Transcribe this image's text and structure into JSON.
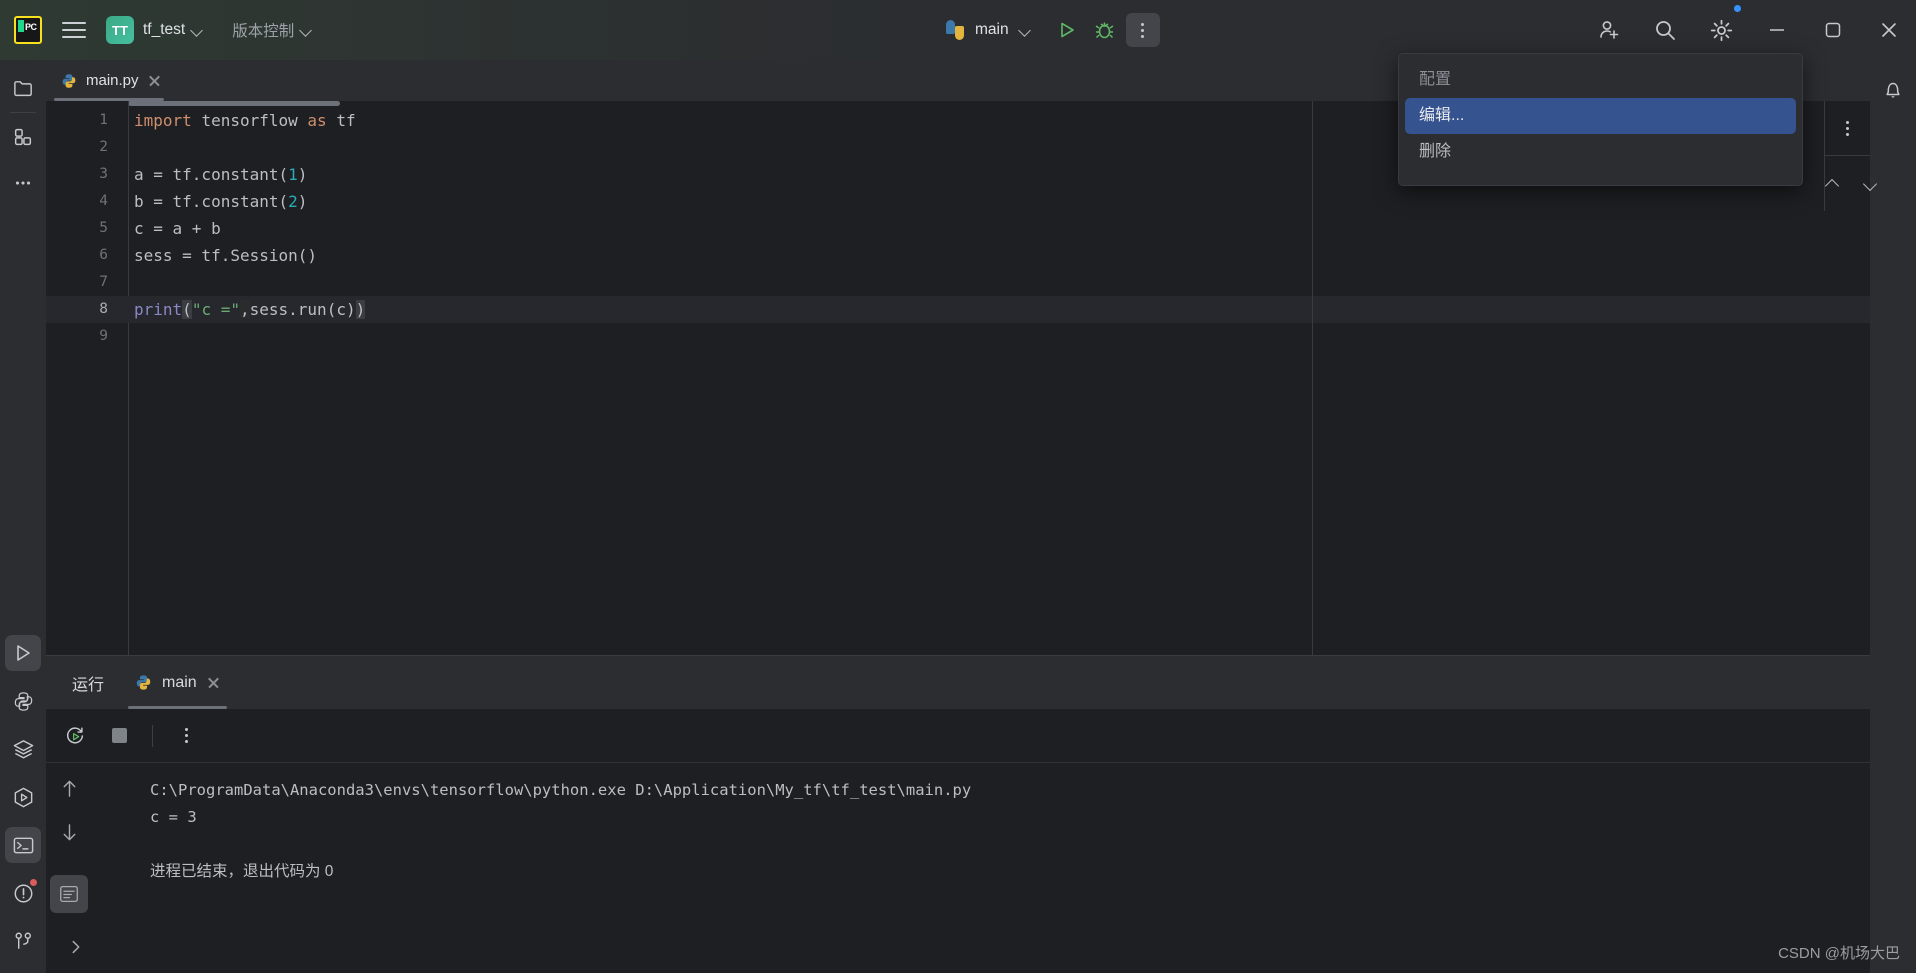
{
  "titlebar": {
    "logo_alt": "PC",
    "project_badge": "TT",
    "project_name": "tf_test",
    "vcs_label": "版本控制",
    "run_config": "main",
    "icons": {
      "hamburger": "hamburger-icon",
      "python": "python-icon",
      "run": "run-icon",
      "debug": "debug-icon",
      "more": "more-vertical-icon",
      "add_user": "add-user-icon",
      "search": "search-icon",
      "settings": "settings-icon",
      "minimize": "minimize-icon",
      "maximize": "maximize-icon",
      "close": "close-icon"
    },
    "accent_green": "#5fb865",
    "badge_blue": "#3592ff"
  },
  "context_menu": {
    "items": [
      {
        "label": "配置",
        "state": "disabled"
      },
      {
        "label": "编辑...",
        "state": "highlighted"
      },
      {
        "label": "删除",
        "state": "normal"
      }
    ],
    "highlight_color": "#35538f"
  },
  "left_rail": {
    "items": [
      {
        "name": "project-tool-window",
        "icon": "folder-icon",
        "selected": false
      },
      {
        "name": "structure-tool-window",
        "icon": "grid-blocks-icon",
        "selected": false
      },
      {
        "name": "more-tool-windows",
        "icon": "ellipsis-icon",
        "selected": false
      },
      {
        "name": "run-tool-window",
        "icon": "run-triangle-icon",
        "selected": true
      },
      {
        "name": "python-console",
        "icon": "python-icon",
        "selected": false
      },
      {
        "name": "services",
        "icon": "layers-icon",
        "selected": false
      },
      {
        "name": "python-packages",
        "icon": "hexagon-play-icon",
        "selected": false
      },
      {
        "name": "terminal",
        "icon": "terminal-icon",
        "selected": true
      },
      {
        "name": "problems",
        "icon": "warning-circle-icon",
        "selected": false,
        "badge": true
      },
      {
        "name": "version-control",
        "icon": "git-branch-icon",
        "selected": false
      }
    ]
  },
  "right_rail": {
    "items": [
      {
        "name": "notifications",
        "icon": "bell-icon"
      }
    ]
  },
  "editor": {
    "tab": {
      "filename": "main.py",
      "icon": "python-file-icon",
      "active": true
    },
    "gutter_width": 82,
    "caret_line": 8,
    "lines": [
      {
        "n": "1",
        "tokens": [
          {
            "t": "import ",
            "c": "kw"
          },
          {
            "t": "tensorflow ",
            "c": "plain"
          },
          {
            "t": "as ",
            "c": "kw"
          },
          {
            "t": "tf",
            "c": "plain"
          }
        ]
      },
      {
        "n": "2",
        "tokens": []
      },
      {
        "n": "3",
        "tokens": [
          {
            "t": "a = tf.constant(",
            "c": "plain"
          },
          {
            "t": "1",
            "c": "num"
          },
          {
            "t": ")",
            "c": "plain"
          }
        ]
      },
      {
        "n": "4",
        "tokens": [
          {
            "t": "b = tf.constant(",
            "c": "plain"
          },
          {
            "t": "2",
            "c": "num"
          },
          {
            "t": ")",
            "c": "plain"
          }
        ]
      },
      {
        "n": "5",
        "tokens": [
          {
            "t": "c = a + b",
            "c": "plain"
          }
        ]
      },
      {
        "n": "6",
        "tokens": [
          {
            "t": "sess = tf.Session()",
            "c": "plain"
          }
        ]
      },
      {
        "n": "7",
        "tokens": []
      },
      {
        "n": "8",
        "tokens": [
          {
            "t": "print",
            "c": "fn"
          },
          {
            "t": "(",
            "c": "paren"
          },
          {
            "t": "\"c =\"",
            "c": "str"
          },
          {
            "t": ",",
            "c": "comma"
          },
          {
            "t": "sess.run(c)",
            "c": "plain"
          },
          {
            "t": ")",
            "c": "paren"
          }
        ]
      },
      {
        "n": "9",
        "tokens": []
      }
    ],
    "toolbar_icons": {
      "more": "more-vertical-icon",
      "prev": "chevron-up-icon",
      "next": "chevron-down-icon"
    }
  },
  "run_window": {
    "title_tab": "运行",
    "session_tab": {
      "label": "main",
      "icon": "python-icon",
      "active": true
    },
    "toolbar": {
      "rerun": "rerun-icon",
      "stop": "stop-icon",
      "more": "more-vertical-icon"
    },
    "side_controls": {
      "up": "arrow-up-icon",
      "down": "arrow-down-icon",
      "soft_wrap": "soft-wrap-icon"
    },
    "console_lines": [
      {
        "text": "C:\\ProgramData\\Anaconda3\\envs\\tensorflow\\python.exe D:\\Application\\My_tf\\tf_test\\main.py",
        "style": "mono"
      },
      {
        "text": "c = 3",
        "style": "mono"
      },
      {
        "text": "",
        "style": "mono"
      },
      {
        "text": "进程已结束，退出代码为 0",
        "style": "cn"
      }
    ]
  },
  "watermark": "CSDN @机场大巴",
  "colors": {
    "bg_editor": "#1e1f22",
    "bg_panel": "#2b2d30",
    "keyword": "#cf8e6d",
    "number": "#2aacb8",
    "string": "#6aab73",
    "function": "#8888c6",
    "text": "#bcbec4"
  }
}
